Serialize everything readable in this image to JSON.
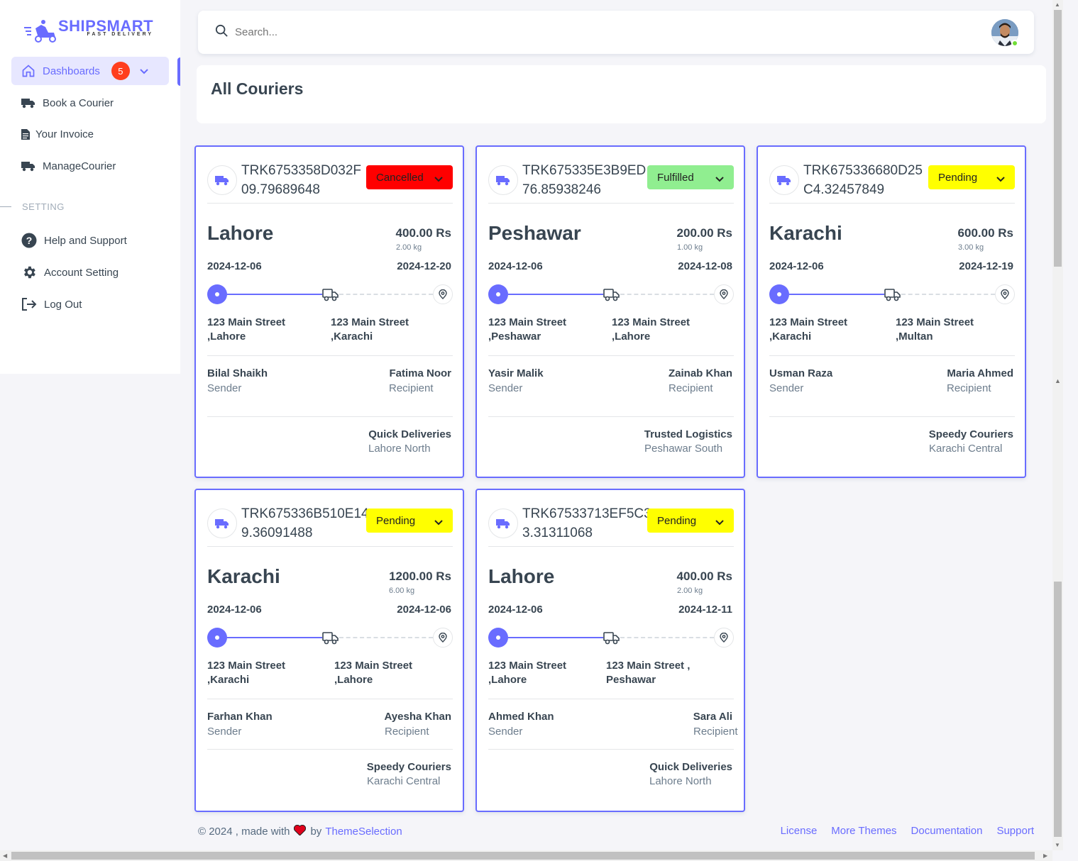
{
  "brand": {
    "name": "SHIPSMART",
    "tagline": "FAST DELIVERY"
  },
  "sidebar": {
    "items": [
      {
        "label": "Dashboards",
        "badge": "5",
        "icon": "home-icon",
        "active": true
      },
      {
        "label": "Book a Courier",
        "icon": "truck-icon"
      },
      {
        "label": "Your Invoice",
        "icon": "invoice-icon"
      },
      {
        "label": "ManageCourier",
        "icon": "truck-icon"
      }
    ],
    "section_label": "SETTING",
    "settings": [
      {
        "label": "Help and Support",
        "icon": "help-icon"
      },
      {
        "label": "Account Setting",
        "icon": "gear-icon"
      },
      {
        "label": "Log Out",
        "icon": "logout-icon"
      }
    ]
  },
  "search": {
    "placeholder": "Search..."
  },
  "page": {
    "title": "All Couriers"
  },
  "couriers": [
    {
      "tracking": "TRK6753358D032F09.79689648",
      "trk1": "TRK6753358D032F",
      "trk2": "09.79689648",
      "status": "Cancelled",
      "status_color": "#ff0000",
      "city": "Lahore",
      "price": "400.00 Rs",
      "weight": "2.00 kg",
      "date_from": "2024-12-06",
      "date_to": "2024-12-20",
      "from_l1": "123 Main Street",
      "from_l2": ",Lahore",
      "to_l1": "123 Main Street",
      "to_l2": ",Karachi",
      "sender": "Bilal Shaikh",
      "sender_role": "Sender",
      "recipient": "Fatima Noor",
      "recipient_role": "Recipient",
      "company": "Quick Deliveries",
      "branch": "Lahore North"
    },
    {
      "tracking": "TRK675335E3B9ED76.85938246",
      "trk1": "TRK675335E3B9ED",
      "trk2": "76.85938246",
      "status": "Fulfilled",
      "status_color": "#90ee90",
      "city": "Peshawar",
      "price": "200.00 Rs",
      "weight": "1.00 kg",
      "date_from": "2024-12-06",
      "date_to": "2024-12-08",
      "from_l1": "123 Main Street",
      "from_l2": ",Peshawar",
      "to_l1": "123 Main Street",
      "to_l2": ",Lahore",
      "sender": "Yasir Malik",
      "sender_role": "Sender",
      "recipient": "Zainab Khan",
      "recipient_role": "Recipient",
      "company": "Trusted Logistics",
      "branch": "Peshawar South"
    },
    {
      "tracking": "TRK675336680D25C4.32457849",
      "trk1": "TRK675336680D25",
      "trk2": "C4.32457849",
      "status": "Pending",
      "status_color": "#ffff00",
      "city": "Karachi",
      "price": "600.00 Rs",
      "weight": "3.00 kg",
      "date_from": "2024-12-06",
      "date_to": "2024-12-19",
      "from_l1": "123 Main Street",
      "from_l2": ",Karachi",
      "to_l1": "123 Main Street",
      "to_l2": ",Multan",
      "sender": "Usman Raza",
      "sender_role": "Sender",
      "recipient": "Maria Ahmed",
      "recipient_role": "Recipient",
      "company": "Speedy Couriers",
      "branch": "Karachi Central"
    },
    {
      "tracking": "TRK675336B510E149.36091488",
      "trk1": "TRK675336B510E14",
      "trk2": "9.36091488",
      "status": "Pending",
      "status_color": "#ffff00",
      "city": "Karachi",
      "price": "1200.00 Rs",
      "weight": "6.00 kg",
      "date_from": "2024-12-06",
      "date_to": "2024-12-06",
      "from_l1": "123 Main Street",
      "from_l2": ",Karachi",
      "to_l1": "123 Main Street",
      "to_l2": ",Lahore",
      "sender": "Farhan Khan",
      "sender_role": "Sender",
      "recipient": "Ayesha Khan",
      "recipient_role": "Recipient",
      "company": "Speedy Couriers",
      "branch": "Karachi Central"
    },
    {
      "tracking": "TRK67533713EF5C33.31311068",
      "trk1": "TRK67533713EF5C3",
      "trk2": "3.31311068",
      "status": "Pending",
      "status_color": "#ffff00",
      "city": "Lahore",
      "price": "400.00 Rs",
      "weight": "2.00 kg",
      "date_from": "2024-12-06",
      "date_to": "2024-12-11",
      "from_l1": "123 Main Street",
      "from_l2": ",Lahore",
      "to_l1": "123 Main Street ,",
      "to_l2": "Peshawar",
      "sender": "Ahmed Khan",
      "sender_role": "Sender",
      "recipient": "Sara Ali",
      "recipient_role": "Recipient",
      "company": "Quick Deliveries",
      "branch": "Lahore North"
    }
  ],
  "footer": {
    "copyright": "© 2024 , made with",
    "by": "by",
    "author": "ThemeSelection",
    "links": [
      "License",
      "More Themes",
      "Documentation",
      "Support"
    ]
  },
  "colors": {
    "accent": "#696cff",
    "danger": "#ff0000",
    "success": "#90ee90",
    "warning": "#ffff00"
  }
}
